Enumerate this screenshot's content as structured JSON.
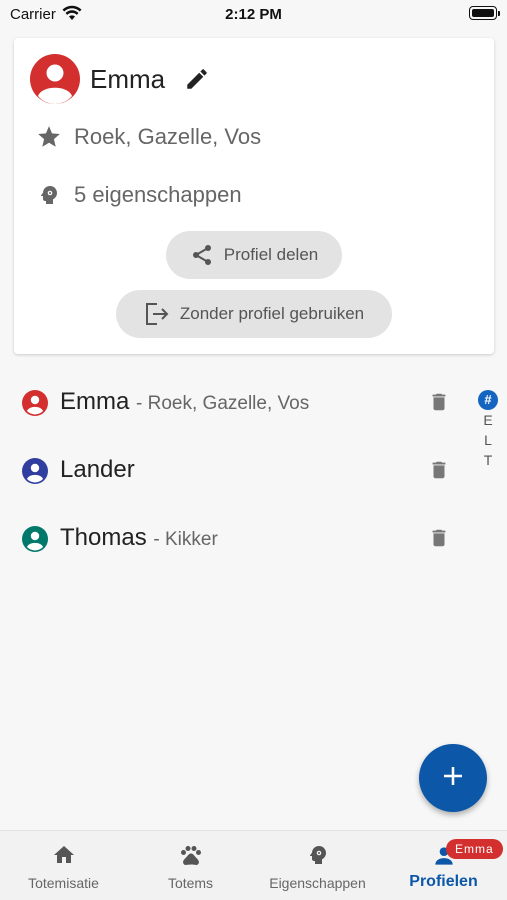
{
  "status_bar": {
    "carrier": "Carrier",
    "time": "2:12 PM"
  },
  "profile_card": {
    "name": "Emma",
    "totems": "Roek, Gazelle, Vos",
    "traits": "5 eigenschappen",
    "share_label": "Profiel delen",
    "no_profile_label": "Zonder profiel gebruiken",
    "avatar_color": "#d32f2f"
  },
  "profiles": [
    {
      "name": "Emma",
      "sub": "- Roek, Gazelle, Vos",
      "color": "#d32f2f"
    },
    {
      "name": "Lander",
      "sub": "",
      "color": "#303f9f"
    },
    {
      "name": "Thomas",
      "sub": "- Kikker",
      "color": "#00796b"
    }
  ],
  "index": {
    "hash": "#",
    "letters": [
      "E",
      "L",
      "T"
    ]
  },
  "fab": {
    "icon": "plus-icon"
  },
  "bottom_nav": {
    "items": [
      {
        "label": "Totemisatie",
        "icon": "home-icon"
      },
      {
        "label": "Totems",
        "icon": "paw-icon"
      },
      {
        "label": "Eigenschappen",
        "icon": "head-gear-icon"
      },
      {
        "label": "Profielen",
        "icon": "person-icon"
      }
    ],
    "badge": "Emma",
    "accent": "#0d57a8"
  }
}
